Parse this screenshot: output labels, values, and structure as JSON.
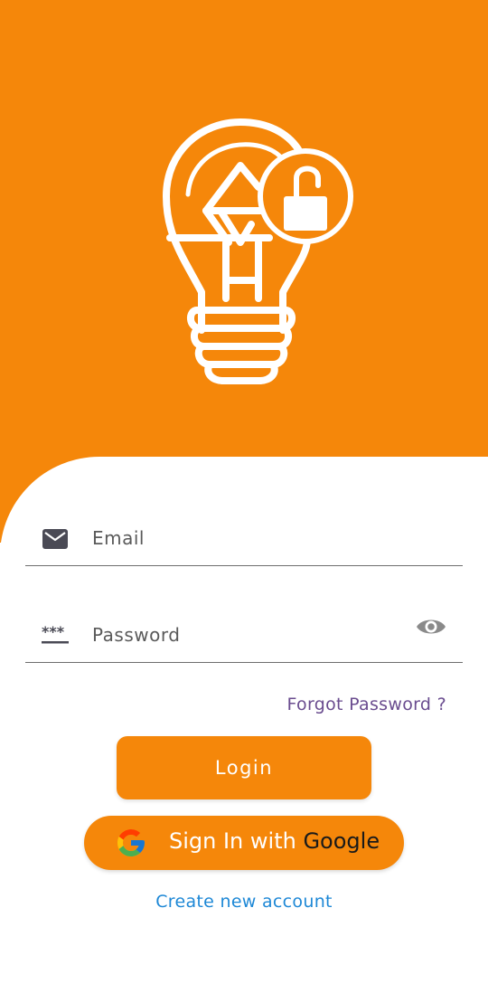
{
  "theme": {
    "primary": "#F5870A",
    "link": "#1e88d6",
    "forgot_link": "#6a4c8f"
  },
  "logo": {
    "icon": "lightbulb-lock-icon"
  },
  "email_field": {
    "icon": "mail-icon",
    "placeholder": "Email",
    "value": ""
  },
  "password_field": {
    "icon": "password-dots-icon",
    "placeholder": "Password",
    "value": "",
    "toggle_icon": "eye-icon"
  },
  "forgot_password": "Forgot Password ?",
  "login_button": "Login",
  "google_button": {
    "prefix": "Sign In with ",
    "brand": "Google",
    "icon": "google-g-icon"
  },
  "create_account": "Create new account"
}
